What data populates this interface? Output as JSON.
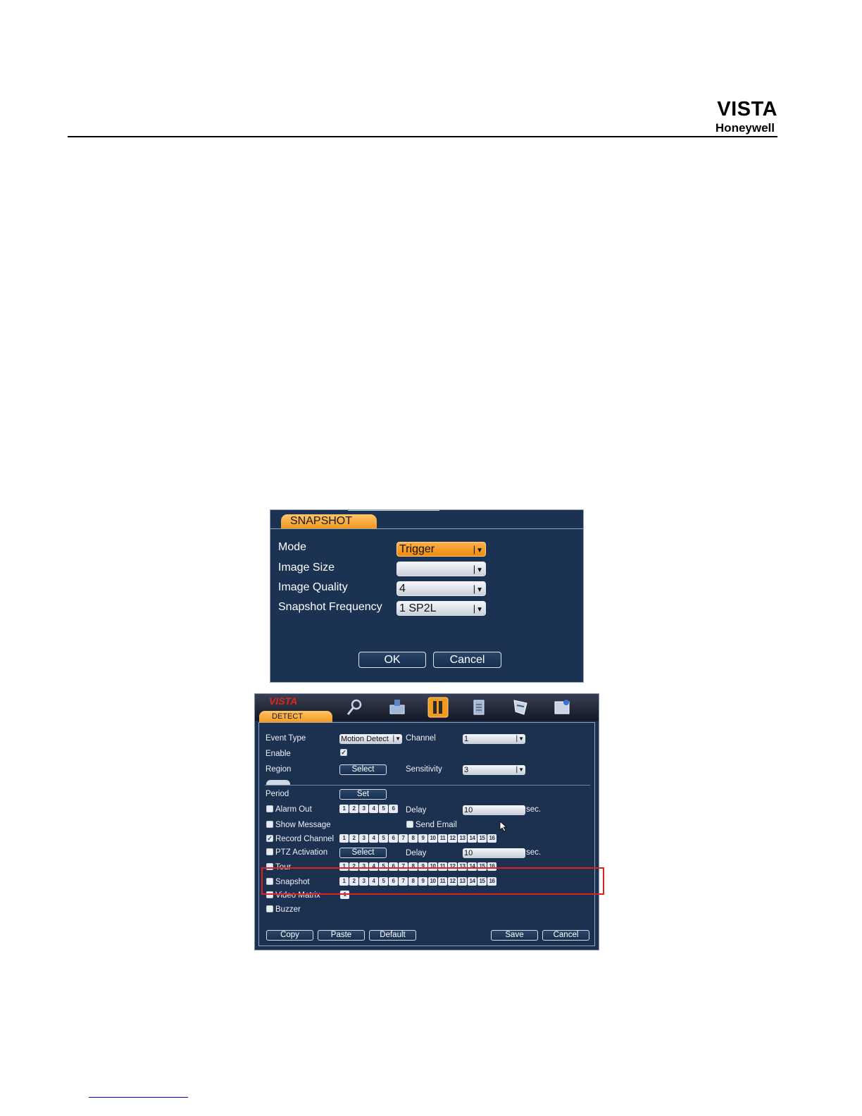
{
  "header": {
    "brand": "VISTA",
    "sub_brand": "Honeywell"
  },
  "snapshot_dialog": {
    "tab": "SNAPSHOT",
    "rows": [
      {
        "label": "Mode",
        "value": "Trigger"
      },
      {
        "label": "Image Size",
        "value": ""
      },
      {
        "label": "Image Quality",
        "value": "4"
      },
      {
        "label": "Snapshot Frequency",
        "value": "1 SP2L"
      }
    ],
    "ok_label": "OK",
    "cancel_label": "Cancel"
  },
  "detect": {
    "brand": "VISTA",
    "tab": "DETECT",
    "toolbar_icons": [
      "search-icon",
      "record-icon",
      "setting-icon",
      "backup-icon",
      "advanced-icon",
      "info-icon"
    ],
    "event_type_label": "Event Type",
    "event_type_value": "Motion Detect",
    "channel_label": "Channel",
    "channel_value": "1",
    "enable_label": "Enable",
    "region_label": "Region",
    "select_label": "Select",
    "sensitivity_label": "Sensitivity",
    "sensitivity_value": "3",
    "period_label": "Period",
    "set_label": "Set",
    "alarm_out_label": "Alarm Out",
    "delay_label": "Delay",
    "delay_value": "10",
    "sec_label": "sec.",
    "show_message_label": "Show Message",
    "send_email_label": "Send Email",
    "record_channel_label": "Record Channel",
    "ptz_label": "PTZ Activation",
    "tour_label": "Tour",
    "snapshot_label": "Snapshot",
    "video_matrix_label": "Video Matrix",
    "buzzer_label": "Buzzer",
    "buttons": {
      "copy": "Copy",
      "paste": "Paste",
      "default": "Default",
      "save": "Save",
      "cancel": "Cancel"
    },
    "alarm_channels": [
      "1",
      "2",
      "3",
      "4",
      "5",
      "6"
    ],
    "channels16": [
      "1",
      "2",
      "3",
      "4",
      "5",
      "6",
      "7",
      "8",
      "9",
      "10",
      "11",
      "12",
      "13",
      "14",
      "15",
      "16"
    ],
    "matrix_channel": "1"
  },
  "colors": {
    "panel_bg": "#1c3252",
    "accent_orange": "#f29a1d",
    "highlight_red": "#e02020"
  }
}
